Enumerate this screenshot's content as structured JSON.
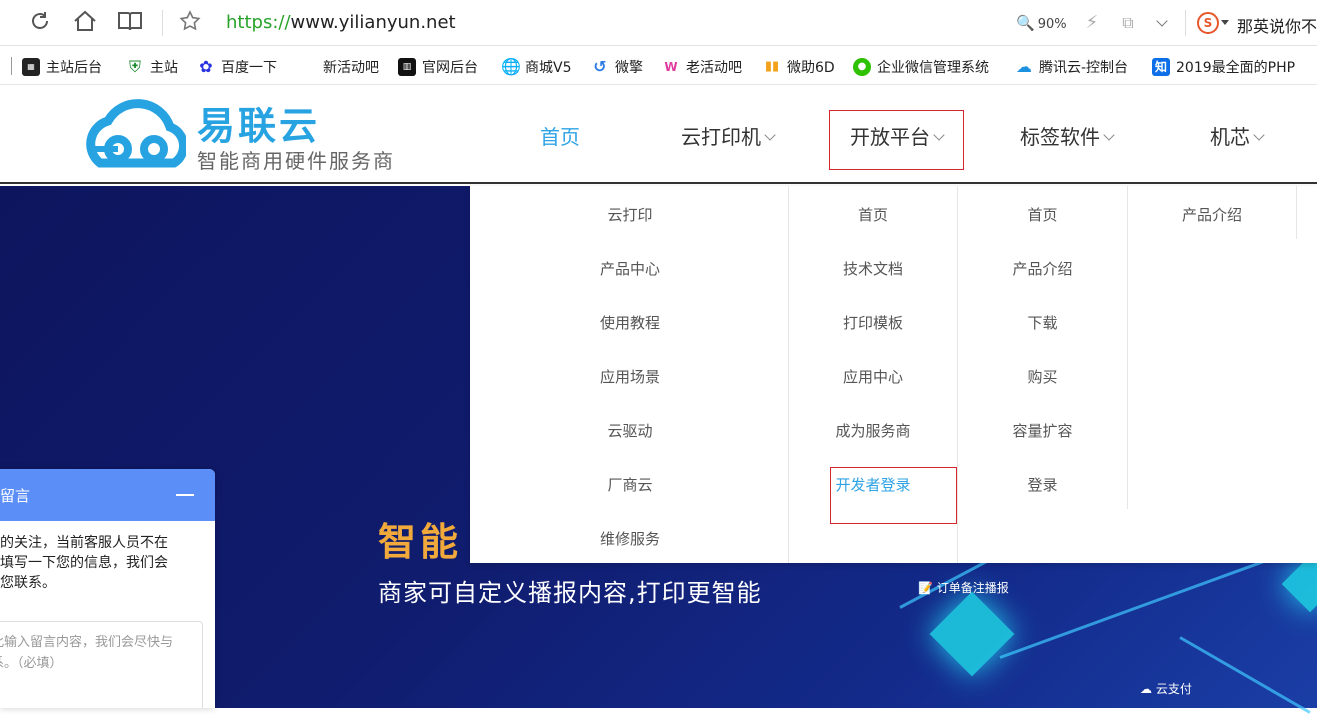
{
  "browser": {
    "url_scheme": "https://",
    "url_host": "www.yilianyun.net",
    "zoom": "90%",
    "search_hint": "那英说你不",
    "icons": [
      "refresh-icon",
      "home-icon",
      "reader-icon",
      "star-icon",
      "zoom-icon",
      "bolt-icon",
      "share-icon",
      "chevron-down-icon",
      "sogou-icon"
    ]
  },
  "bookmarks": [
    {
      "label": "主站后台",
      "icon": "site-admin-icon"
    },
    {
      "label": "主站",
      "icon": "shield-icon"
    },
    {
      "label": "百度一下",
      "icon": "baidu-icon"
    },
    {
      "label": "新活动吧",
      "icon": ""
    },
    {
      "label": "官网后台",
      "icon": "admin-icon"
    },
    {
      "label": "商城V5",
      "icon": "globe-icon"
    },
    {
      "label": "微擎",
      "icon": "weiqing-icon"
    },
    {
      "label": "老活动吧",
      "icon": "wave-icon"
    },
    {
      "label": "微助6D",
      "icon": "bars-icon"
    },
    {
      "label": "企业微信管理系统",
      "icon": "wechat-icon"
    },
    {
      "label": "腾讯云-控制台",
      "icon": "cloud-icon"
    },
    {
      "label": "2019最全面的PHP",
      "icon": "zhihu-icon"
    }
  ],
  "site": {
    "logo_title": "易联云",
    "logo_sub": "智能商用硬件服务商",
    "nav": [
      {
        "label": "首页",
        "active": true,
        "dropdown": false
      },
      {
        "label": "云打印机",
        "active": false,
        "dropdown": true
      },
      {
        "label": "开放平台",
        "active": false,
        "dropdown": true
      },
      {
        "label": "标签软件",
        "active": false,
        "dropdown": true
      },
      {
        "label": "机芯",
        "active": false,
        "dropdown": true
      }
    ]
  },
  "mega_menu": {
    "columns": [
      [
        "云打印",
        "产品中心",
        "使用教程",
        "应用场景",
        "云驱动",
        "厂商云",
        "维修服务"
      ],
      [
        "首页",
        "技术文档",
        "打印模板",
        "应用中心",
        "成为服务商",
        "开发者登录"
      ],
      [
        "首页",
        "产品介绍",
        "下载",
        "购买",
        "容量扩容",
        "登录"
      ],
      [
        "产品介绍"
      ]
    ],
    "highlighted": "开发者登录"
  },
  "hero": {
    "title": "智能",
    "subtitle": "商家可自定义播报内容,打印更智能",
    "tags": [
      "订单备注播报",
      "云支付"
    ]
  },
  "chat": {
    "title": "留言",
    "message": "您的关注，当前客服人员不在\n请填写一下您的信息，我们会\n和您联系。",
    "input_placeholder": "此输入留言内容，我们会尽快与\n系。（必填）"
  }
}
